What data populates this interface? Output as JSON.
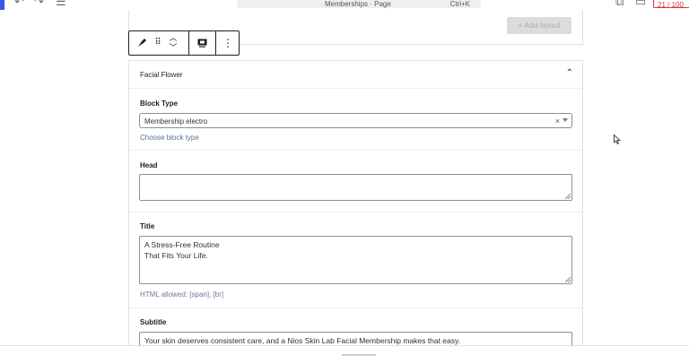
{
  "topbar": {
    "command_title": "Memberships · Page",
    "command_shortcut": "Ctrl+K",
    "counter": "21 / 100",
    "accent_color": "#3858e9",
    "icons": [
      "undo-icon",
      "redo-icon",
      "document-overview-icon",
      "external-link-icon",
      "preview-icon"
    ]
  },
  "previous_block": {
    "add_layout_label": "+ Add layout"
  },
  "block_toolbar": {
    "icons": [
      "block-icon",
      "drag-handle-icon",
      "move-up-icon",
      "move-down-icon",
      "preview-mode-icon",
      "more-options-icon"
    ]
  },
  "panel": {
    "title": "Facial Flower",
    "fields": {
      "block_type": {
        "label": "Block Type",
        "value": "Membership electro",
        "clear": "×",
        "link": "Choose block type"
      },
      "head": {
        "label": "Head",
        "value": ""
      },
      "title": {
        "label": "Title",
        "line1": "A Stress-Free Routine",
        "line2": "That Fits Your Life.",
        "hint": "HTML allowed: [span], [br]"
      },
      "subtitle": {
        "label": "Subtitle",
        "value": "Your skin deserves consistent care, and a Nios Skin Lab Facial Membership makes that easy."
      }
    }
  }
}
